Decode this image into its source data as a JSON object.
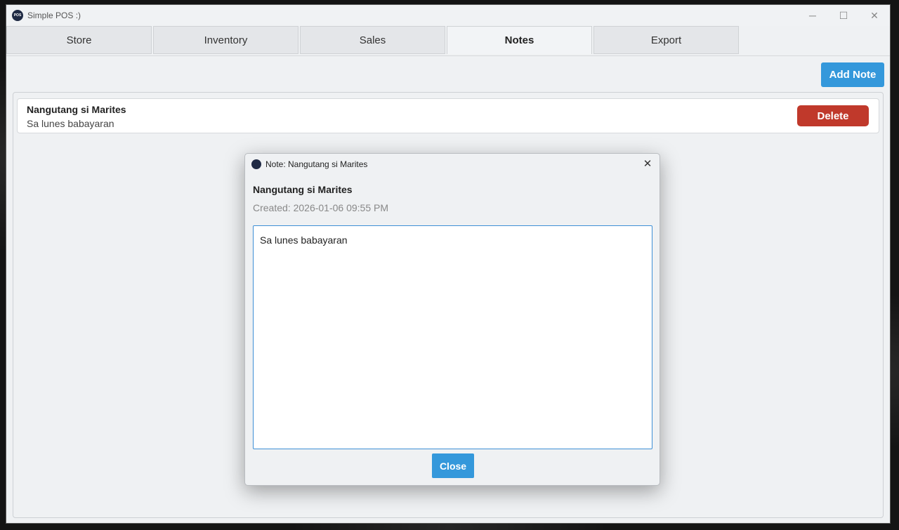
{
  "window": {
    "title": "Simple POS :)",
    "icon": "app-logo-icon",
    "controls": {
      "minimize": "─",
      "maximize": "☐",
      "close": "✕"
    }
  },
  "tabs": [
    {
      "label": "Store",
      "active": false
    },
    {
      "label": "Inventory",
      "active": false
    },
    {
      "label": "Sales",
      "active": false
    },
    {
      "label": "Notes",
      "active": true
    },
    {
      "label": "Export",
      "active": false
    }
  ],
  "toolbar": {
    "add_note_label": "Add Note"
  },
  "notes": [
    {
      "title": "Nangutang si Marites",
      "preview": "Sa lunes babayaran",
      "delete_label": "Delete"
    }
  ],
  "dialog": {
    "title": "Note: Nangutang si Marites",
    "close_icon": "✕",
    "heading": "Nangutang si Marites",
    "created": "Created: 2026-01-06 09:55 PM",
    "body": "Sa lunes babayaran",
    "close_label": "Close"
  },
  "colors": {
    "accent": "#3498db",
    "danger": "#c0392b",
    "background": "#eff1f3"
  }
}
